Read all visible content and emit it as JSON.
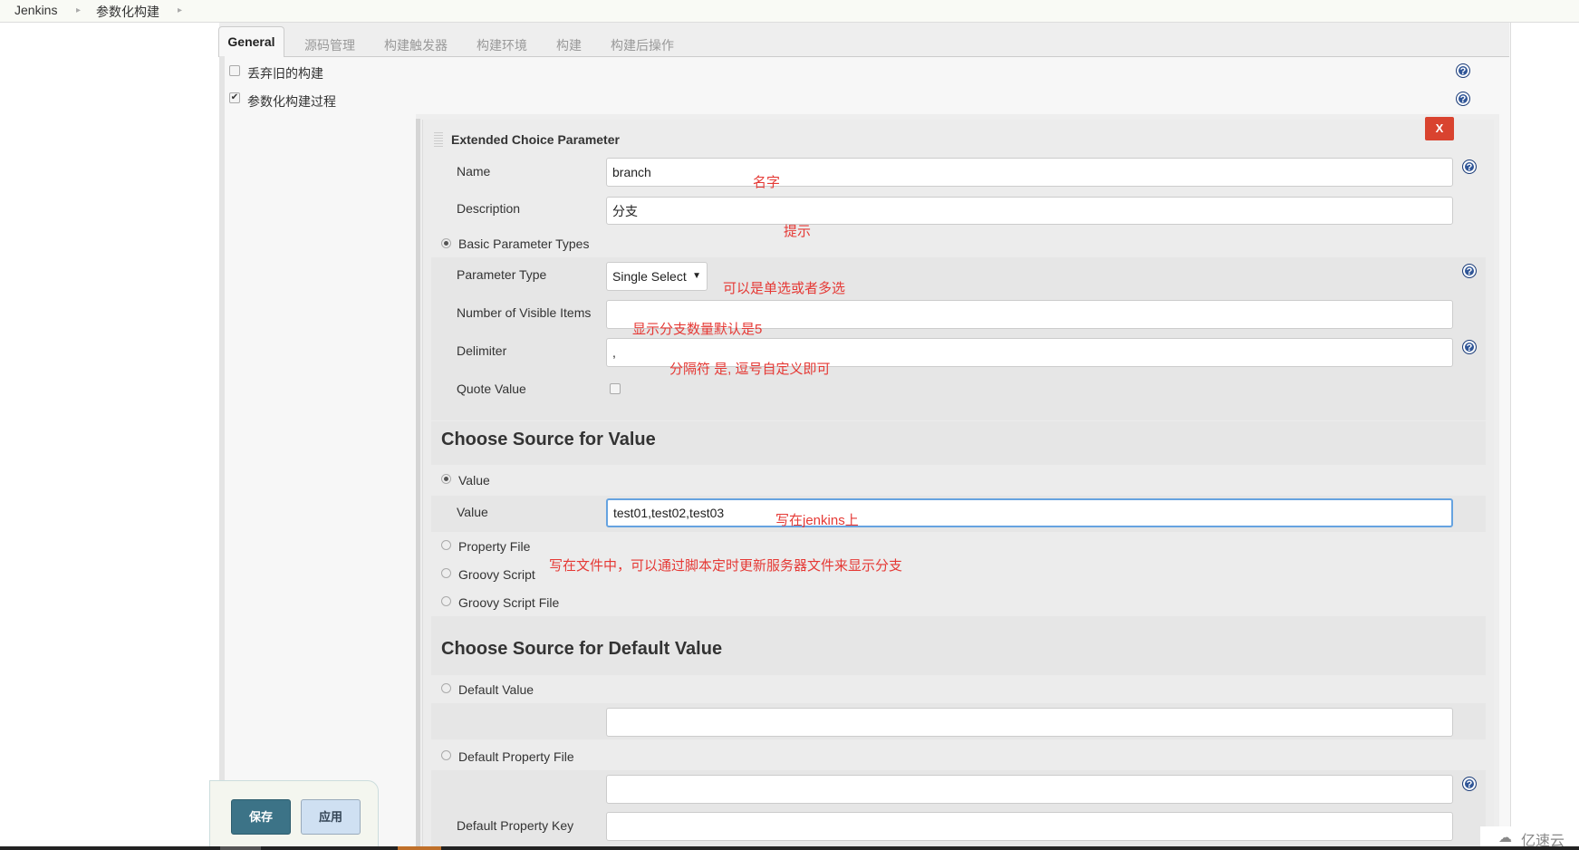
{
  "breadcrumb": {
    "items": [
      "Jenkins",
      "参数化构建"
    ]
  },
  "tabs": [
    {
      "label": "General",
      "active": true
    },
    {
      "label": "源码管理"
    },
    {
      "label": "构建触发器"
    },
    {
      "label": "构建环境"
    },
    {
      "label": "构建"
    },
    {
      "label": "构建后操作"
    }
  ],
  "general": {
    "discard_old": {
      "label": "丢弃旧的构建",
      "checked": false
    },
    "parameterized": {
      "label": "参数化构建过程",
      "checked": true
    }
  },
  "param": {
    "title": "Extended Choice Parameter",
    "delete_label": "X",
    "name_label": "Name",
    "name_value": "branch",
    "description_label": "Description",
    "description_value": "分支",
    "basic_types_label": "Basic Parameter Types",
    "param_type_label": "Parameter Type",
    "param_type_value": "Single Select",
    "visible_items_label": "Number of Visible Items",
    "visible_items_value": "",
    "delimiter_label": "Delimiter",
    "delimiter_value": ",",
    "quote_value_label": "Quote Value",
    "source_heading": "Choose Source for Value",
    "source_options": [
      "Value",
      "Property File",
      "Groovy Script",
      "Groovy Script File"
    ],
    "value_label": "Value",
    "value_value": "test01,test02,test03",
    "default_heading": "Choose Source for Default Value",
    "default_value_label": "Default Value",
    "default_value_value": "",
    "default_property_file_label": "Default Property File",
    "default_property_file_value": "",
    "default_property_key_label": "Default Property Key",
    "default_property_key_value": ""
  },
  "annotations": {
    "name": "名字",
    "description": "提示",
    "param_type": "可以是单选或者多选",
    "visible_items": "显示分支数量默认是5",
    "delimiter": "分隔符 是, 逗号自定义即可",
    "value": "写在jenkins上",
    "file": "写在文件中，可以通过脚本定时更新服务器文件来显示分支"
  },
  "buttons": {
    "save": "保存",
    "apply": "应用"
  },
  "watermark": "亿速云",
  "colors": {
    "annotation": "#e53935",
    "delete": "#d9432f",
    "save": "#3c7387",
    "apply": "#cfe0f2",
    "focus": "#66a3e0"
  }
}
